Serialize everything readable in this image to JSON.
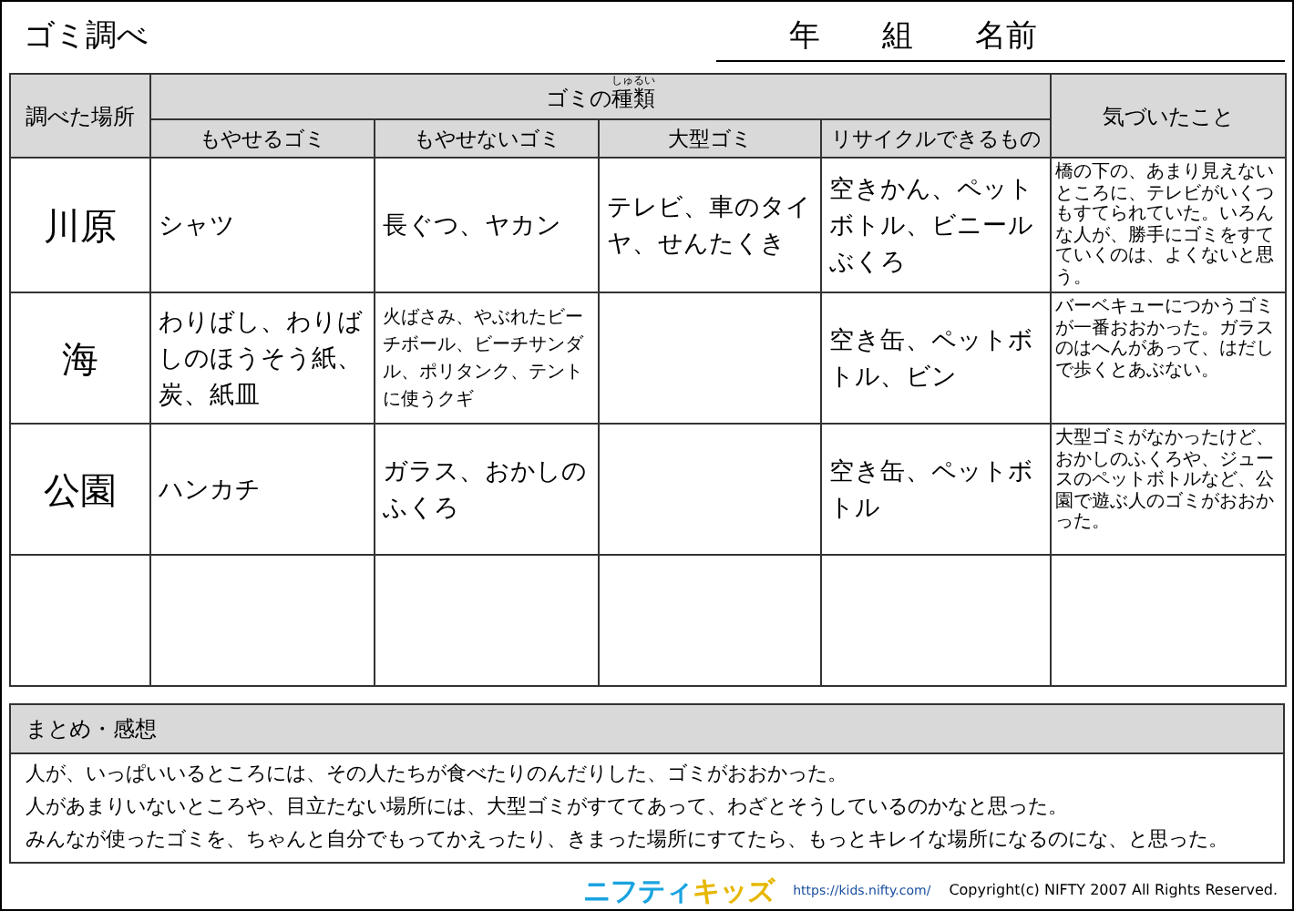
{
  "title": "ゴミ調べ",
  "name_line": [
    "年",
    "組",
    "名前"
  ],
  "table": {
    "place_heading": "調べた場所",
    "types_heading": {
      "text": "ゴミの",
      "ruby_base": "種類",
      "ruby": "しゅるい"
    },
    "columns": [
      "もやせるゴミ",
      "もやせないゴミ",
      "大型ゴミ",
      "リサイクルできるもの"
    ],
    "notes_heading": "気づいたこと",
    "rows": [
      {
        "place": "川原",
        "cells": [
          {
            "text": "シャツ",
            "fine_print": false
          },
          {
            "text": "長ぐつ、ヤカン",
            "fine_print": false
          },
          {
            "text": "テレビ、車のタイヤ、せんたくき",
            "fine_print": false
          },
          {
            "text": "空きかん、ペットボトル、ビニールぶくろ",
            "fine_print": false
          }
        ],
        "notes": "橋の下の、あまり見えないところに、テレビがいくつもすてられていた。いろんな人が、勝手にゴミをすてていくのは、よくないと思う。"
      },
      {
        "place": "海",
        "cells": [
          {
            "text": "わりばし、わりばしのほうそう紙、炭、紙皿",
            "fine_print": false
          },
          {
            "text": "火ばさみ、やぶれたビーチボール、ビーチサンダル、ポリタンク、テントに使うクギ",
            "fine_print": true
          },
          {},
          {
            "text": "空き缶、ペットボトル、ビン",
            "fine_print": false
          }
        ],
        "notes": "バーベキューにつかうゴミが一番おおかった。ガラスのはへんがあって、はだしで歩くとあぶない。"
      },
      {
        "place": "公園",
        "cells": [
          {
            "text": "ハンカチ",
            "fine_print": false
          },
          {
            "text": "ガラス、おかしのふくろ",
            "fine_print": false
          },
          {},
          {
            "text": "空き缶、ペットボトル",
            "fine_print": false
          }
        ],
        "notes": "大型ゴミがなかったけど、おかしのふくろや、ジュースのペットボトルなど、公園で遊ぶ人のゴミがおおかった。"
      }
    ]
  },
  "summary": {
    "heading": "まとめ・感想",
    "lines": [
      "人が、いっぱいいるところには、その人たちが食べたりのんだりした、ゴミがおおかった。",
      "人があまりいないところや、目立たない場所には、大型ゴミがすててあって、わざとそうしているのかなと思った。",
      "みんなが使ったゴミを、ちゃんと自分でもってかえったり、きまった場所にすてたら、もっとキレイな場所になるのにな、と思った。"
    ]
  },
  "footer": {
    "logo": [
      "ニフティ",
      "キッズ"
    ],
    "url": "https://kids.nifty.com/",
    "copyright": "Copyright(c) NIFTY 2007 All Rights Reserved."
  }
}
